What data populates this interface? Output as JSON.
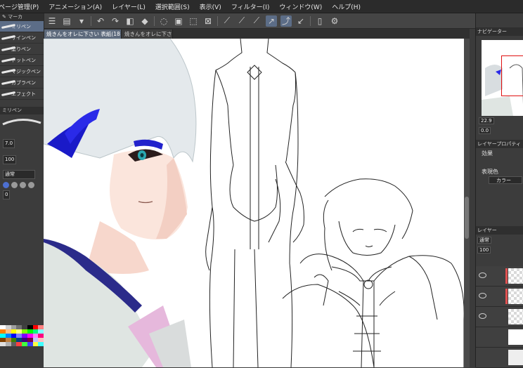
{
  "menubar": {
    "items": [
      "ページ管理(P)",
      "アニメーション(A)",
      "レイヤー(L)",
      "選択範囲(S)",
      "表示(V)",
      "フィルター(I)",
      "ウィンドウ(W)",
      "ヘルプ(H)"
    ]
  },
  "tabs": [
    {
      "label": "焼きんをオレに下さい 表紙(18",
      "active": true
    },
    {
      "label": "焼きんをオレに下さい",
      "active": false
    }
  ],
  "tool_panel": {
    "header": "マーカ",
    "brushes": [
      "ミリペン",
      "サインペン",
      "塗りペン",
      "ドットペン",
      "マジックペン",
      "カブラペン",
      "エフェクト"
    ],
    "subheader": "ミリペン",
    "brush_size": "7.0",
    "opacity": "100",
    "blend_mode": "通常",
    "hardness_value": "0"
  },
  "navigator": {
    "header": "ナビゲーター",
    "zoom": "22.9",
    "rotation": "0.0"
  },
  "layer_property": {
    "header": "レイヤープロパティ",
    "effect_label": "効果",
    "color_label": "表現色",
    "color_value": "カラー"
  },
  "layers": {
    "header": "レイヤー",
    "blend_mode": "通常",
    "opacity_value": "100"
  },
  "icons": {
    "close": "close-icon",
    "pen": "pen-icon",
    "undo": "undo-icon",
    "redo": "redo-icon",
    "lasso": "lasso-icon",
    "rotate": "rotate-icon"
  }
}
